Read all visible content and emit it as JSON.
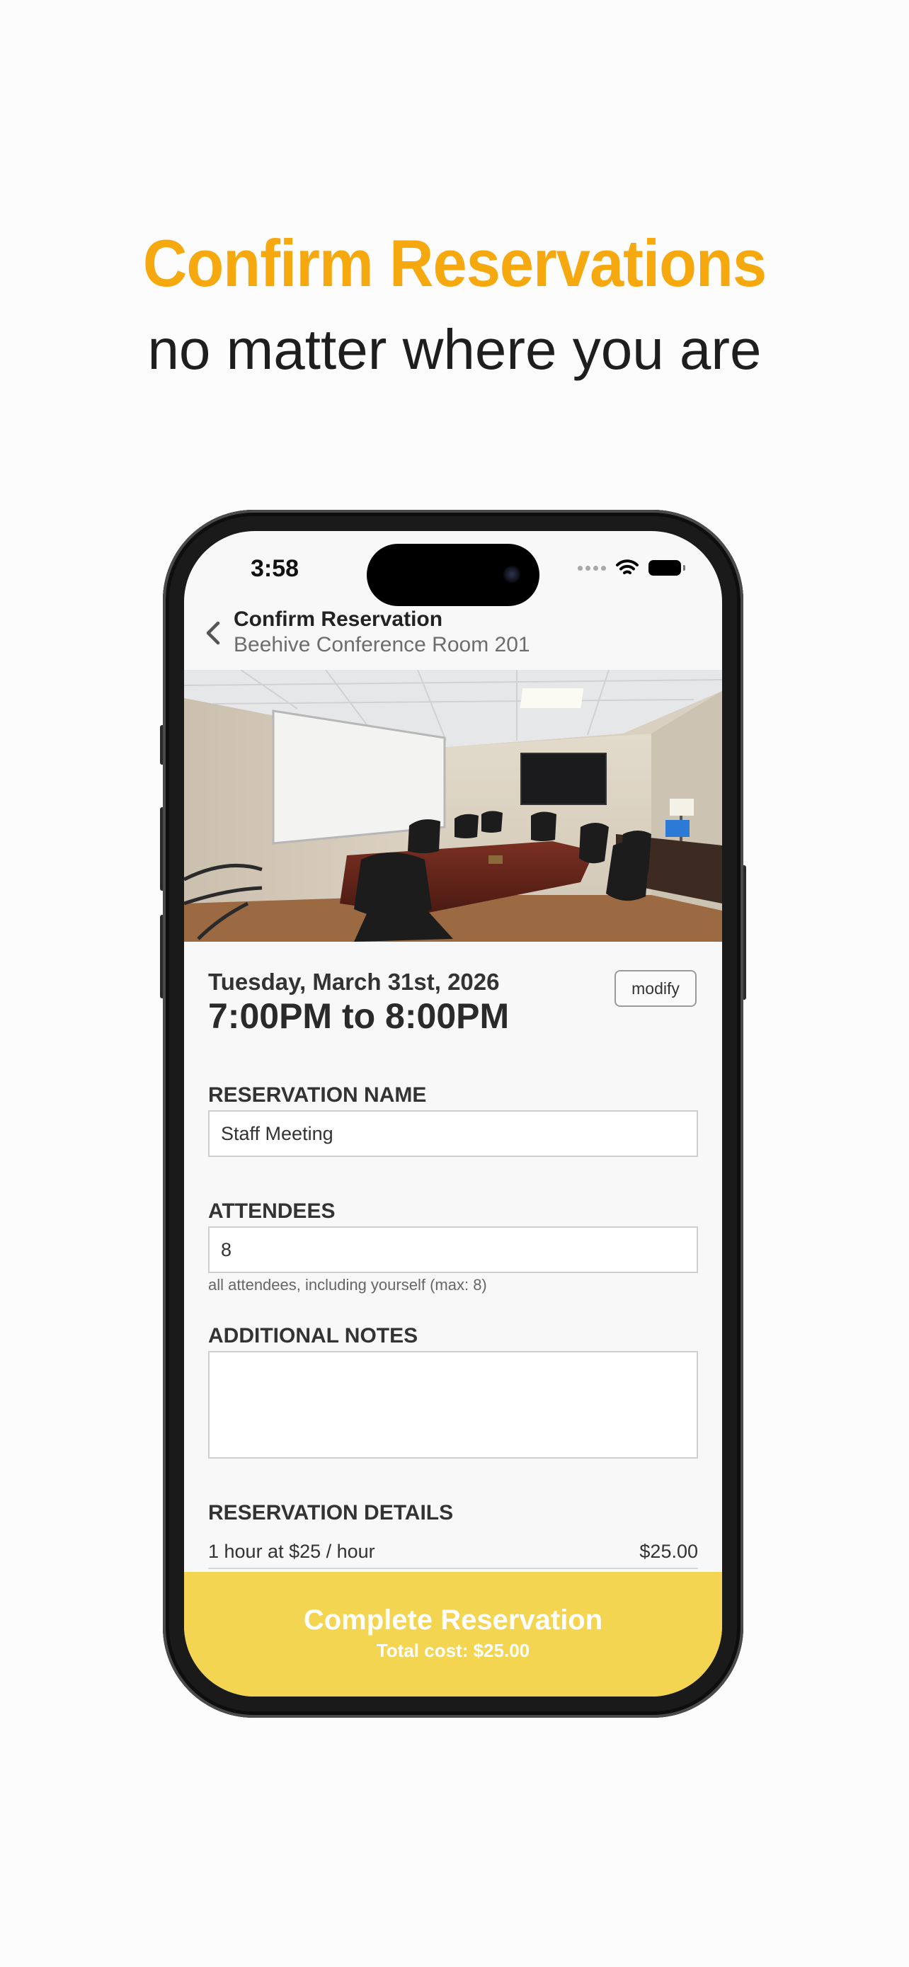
{
  "promo": {
    "headline": "Confirm Reservations",
    "subline": "no matter where you are"
  },
  "status_bar": {
    "time": "3:58",
    "icons": [
      "signal-dots-icon",
      "wifi-icon",
      "battery-icon"
    ]
  },
  "nav": {
    "back_icon": "chevron-left-icon",
    "title": "Confirm Reservation",
    "subtitle": "Beehive Conference Room 201"
  },
  "booking": {
    "date": "Tuesday, March 31st, 2026",
    "time_range": "7:00PM to 8:00PM",
    "modify_label": "modify"
  },
  "form": {
    "name_label": "RESERVATION NAME",
    "name_value": "Staff Meeting",
    "attendees_label": "ATTENDEES",
    "attendees_value": "8",
    "attendees_hint": "all attendees, including yourself (max: 8)",
    "notes_label": "ADDITIONAL NOTES",
    "notes_value": ""
  },
  "details": {
    "heading": "RESERVATION DETAILS",
    "line_desc": "1 hour at $25 / hour",
    "line_amount": "$25.00"
  },
  "cta": {
    "label": "Complete Reservation",
    "total": "Total cost: $25.00"
  },
  "colors": {
    "headline": "#f6a80f",
    "cta_background": "#f3d551"
  }
}
